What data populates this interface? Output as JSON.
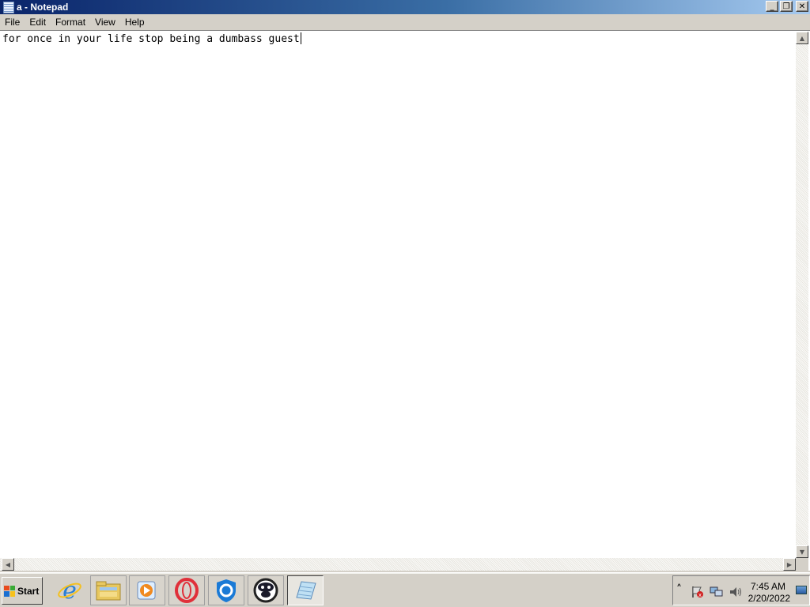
{
  "window": {
    "title": "a - Notepad",
    "minimize_glyph": "_",
    "restore_glyph": "❐",
    "close_glyph": "✕"
  },
  "menu": {
    "items": [
      "File",
      "Edit",
      "Format",
      "View",
      "Help"
    ]
  },
  "editor": {
    "content": "for once in your life stop being a dumbass guest"
  },
  "scrollbar": {
    "up_glyph": "▲",
    "down_glyph": "▼",
    "left_glyph": "◀",
    "right_glyph": "▶"
  },
  "taskbar": {
    "start_label": "Start",
    "pinned": [
      {
        "name": "internet-explorer-icon"
      },
      {
        "name": "file-explorer-icon"
      },
      {
        "name": "media-player-icon"
      },
      {
        "name": "opera-icon"
      },
      {
        "name": "shield-browser-icon"
      },
      {
        "name": "penguin-app-icon"
      },
      {
        "name": "notepad-icon"
      }
    ]
  },
  "tray": {
    "chevron": "˄",
    "time": "7:45 AM",
    "date": "2/20/2022"
  },
  "colors": {
    "title_gradient_start": "#0a246a",
    "title_gradient_end": "#a6caf0",
    "chrome": "#d4d0c8",
    "editor_bg": "#ffffff"
  }
}
